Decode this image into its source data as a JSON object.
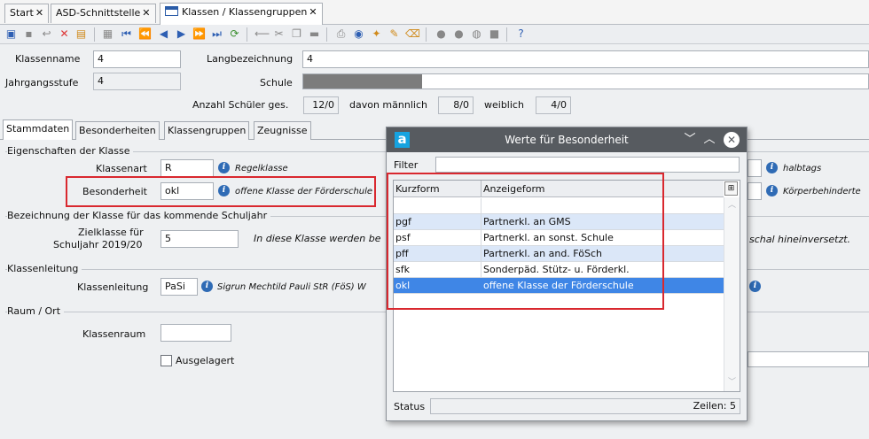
{
  "tabs": [
    {
      "label": "Start"
    },
    {
      "label": "ASD-Schnittstelle"
    },
    {
      "label": "Klassen / Klassengruppen"
    }
  ],
  "header": {
    "klassenname_label": "Klassenname",
    "klassenname_value": "4",
    "langbezeichnung_label": "Langbezeichnung",
    "langbezeichnung_value": "4",
    "jahrgangsstufe_label": "Jahrgangsstufe",
    "jahrgangsstufe_value": "4",
    "schule_label": "Schule",
    "schule_fill_fraction": 0.21,
    "anzahl_label": "Anzahl Schüler ges.",
    "anzahl_value": "12/0",
    "maennlich_label": "davon männlich",
    "maennlich_value": "8/0",
    "weiblich_label": "weiblich",
    "weiblich_value": "4/0"
  },
  "form_tabs": [
    "Stammdaten",
    "Besonderheiten",
    "Klassengruppen",
    "Zeugnisse"
  ],
  "eigenschaften": {
    "title": "Eigenschaften der Klasse",
    "klassenart_label": "Klassenart",
    "klassenart_value": "R",
    "klassenart_hint": "Regelklasse",
    "besonderheit_label": "Besonderheit",
    "besonderheit_value": "okl",
    "besonderheit_hint": "offene Klasse der Förderschule",
    "right_hint_1": "halbtags",
    "right_hint_2": "Körperbehinderte"
  },
  "bezeichnung": {
    "title": "Bezeichnung der Klasse für das kommende Schuljahr",
    "zielklasse_label_1": "Zielklasse für",
    "zielklasse_label_2": "Schuljahr 2019/20",
    "zielklasse_value": "5",
    "hint_left": "In diese Klasse werden be",
    "hint_right": "schal hineinversetzt."
  },
  "klassenleitung": {
    "title": "Klassenleitung",
    "label": "Klassenleitung",
    "value": "PaSi",
    "hint": "Sigrun Mechtild Pauli StR (FöS) W"
  },
  "raum": {
    "title": "Raum / Ort",
    "klassenraum_label": "Klassenraum",
    "klassenraum_value": "",
    "ausgelagert_label": "Ausgelagert"
  },
  "popup": {
    "title": "Werte für Besonderheit",
    "filter_label": "Filter",
    "filter_value": "",
    "columns": [
      "Kurzform",
      "Anzeigeform"
    ],
    "rows": [
      {
        "kurz": "",
        "anzeige": ""
      },
      {
        "kurz": "pgf",
        "anzeige": "Partnerkl. an GMS"
      },
      {
        "kurz": "psf",
        "anzeige": "Partnerkl. an sonst. Schule"
      },
      {
        "kurz": "pff",
        "anzeige": "Partnerkl. an and. FöSch"
      },
      {
        "kurz": "sfk",
        "anzeige": "Sonderpäd. Stütz- u. Förderkl."
      },
      {
        "kurz": "okl",
        "anzeige": "offene Klasse der Förderschule"
      }
    ],
    "status_label": "Status",
    "status_value": "",
    "zeilen_text": "Zeilen: 5"
  },
  "colors": {
    "highlight_box": "#d9282f",
    "selected_row": "#3f86e6",
    "alt_row": "#dbe7f8"
  }
}
